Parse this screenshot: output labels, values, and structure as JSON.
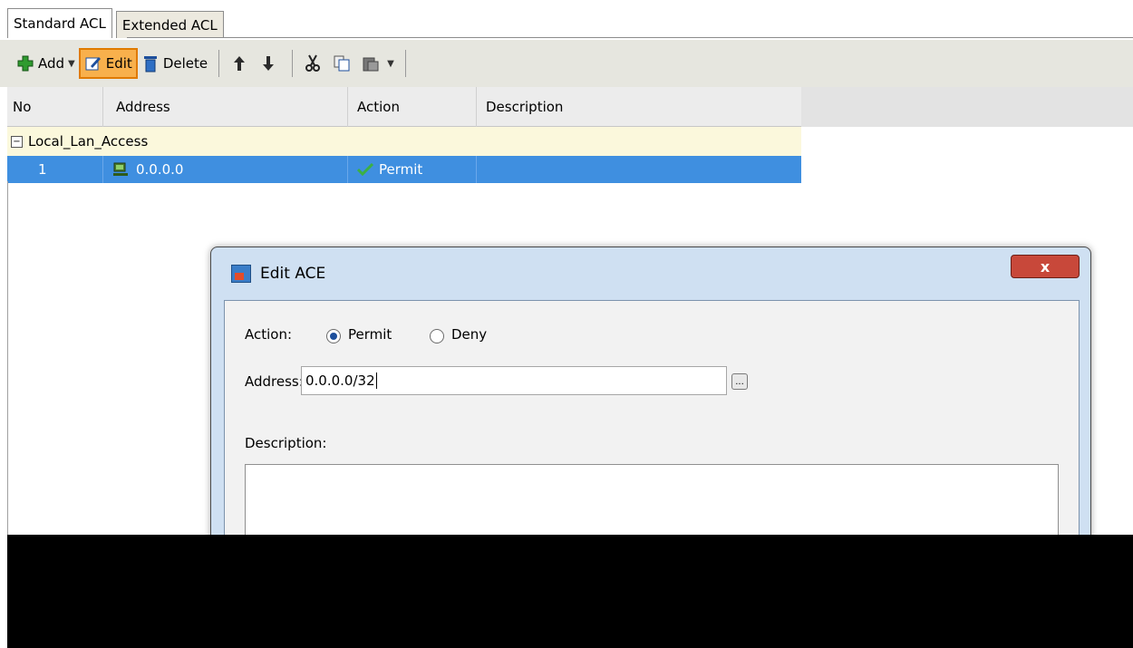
{
  "tabs": [
    {
      "label": "Standard ACL",
      "active": true
    },
    {
      "label": "Extended ACL",
      "active": false
    }
  ],
  "toolbar": {
    "add_label": "Add",
    "edit_label": "Edit",
    "delete_label": "Delete"
  },
  "table": {
    "columns": [
      "No",
      "Address",
      "Action",
      "Description"
    ],
    "group": "Local_Lan_Access",
    "rows": [
      {
        "no": "1",
        "address": "0.0.0.0",
        "action": "Permit",
        "description": ""
      }
    ]
  },
  "dialog": {
    "title": "Edit ACE",
    "close_label": "x",
    "action_label": "Action:",
    "action_options": [
      "Permit",
      "Deny"
    ],
    "selected_action": "Permit",
    "address_label": "Address:",
    "address_value": "0.0.0.0/32",
    "browse_label": "...",
    "description_label": "Description:",
    "description_value": ""
  },
  "colors": {
    "selected_row": "#3f8fe0",
    "group_row": "#fbf8dc",
    "edit_highlight": "#f8b04c",
    "close_button": "#c8483a"
  }
}
